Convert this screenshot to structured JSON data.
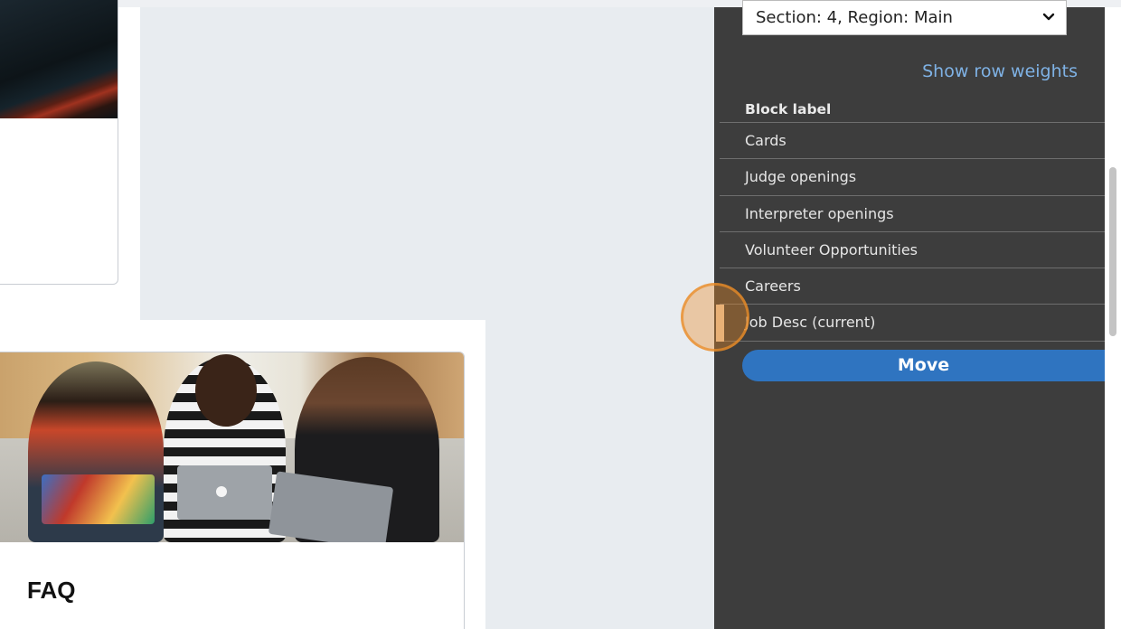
{
  "panel": {
    "region_select": "Section: 4, Region: Main",
    "show_row_weights": "Show row weights",
    "block_header": "Block label",
    "blocks": [
      "Cards",
      "Judge openings",
      "Interpreter openings",
      "Volunteer Opportunities",
      "Careers",
      "Job Desc (current)"
    ],
    "move_label": "Move",
    "accent_color": "#2f74c0",
    "link_color": "#7fb2e5"
  },
  "content": {
    "faq_title": "FAQ"
  },
  "icons": {
    "select": "chevron-down-icon"
  }
}
